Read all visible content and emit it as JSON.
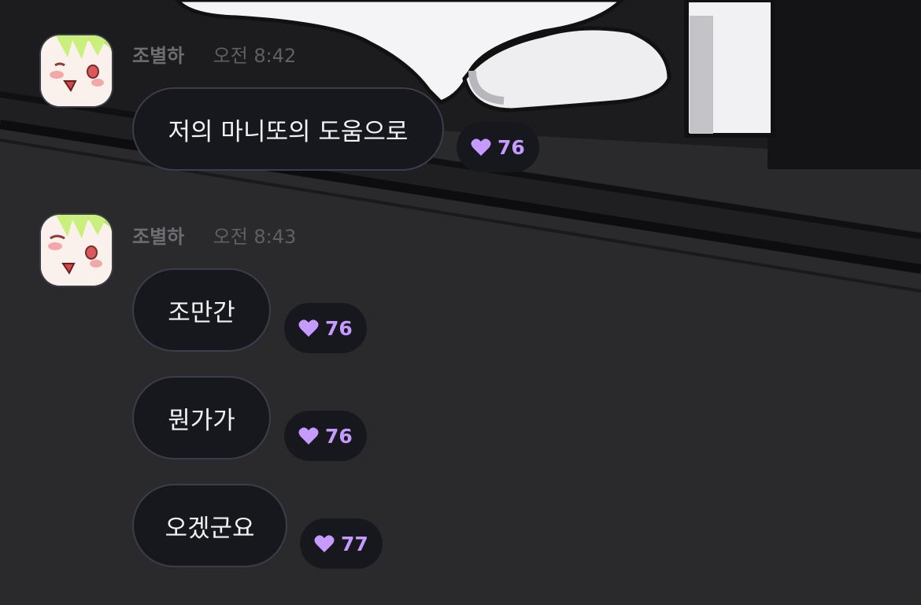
{
  "groups": [
    {
      "sender": "조별하",
      "time": "오전 8:42",
      "messages": [
        {
          "text": "저의 마니또의 도움으로",
          "reactions": "76"
        }
      ]
    },
    {
      "sender": "조별하",
      "time": "오전 8:43",
      "messages": [
        {
          "text": "조만간",
          "reactions": "76"
        },
        {
          "text": "뭔가가",
          "reactions": "76"
        },
        {
          "text": "오겠군요",
          "reactions": "77"
        }
      ]
    }
  ],
  "colors": {
    "background": "#2a2a2d",
    "bubble": "#17181d",
    "bubble_border": "#3a3d4b",
    "reaction_accent": "#c59bff"
  },
  "icons": {
    "reaction": "heart-icon"
  }
}
